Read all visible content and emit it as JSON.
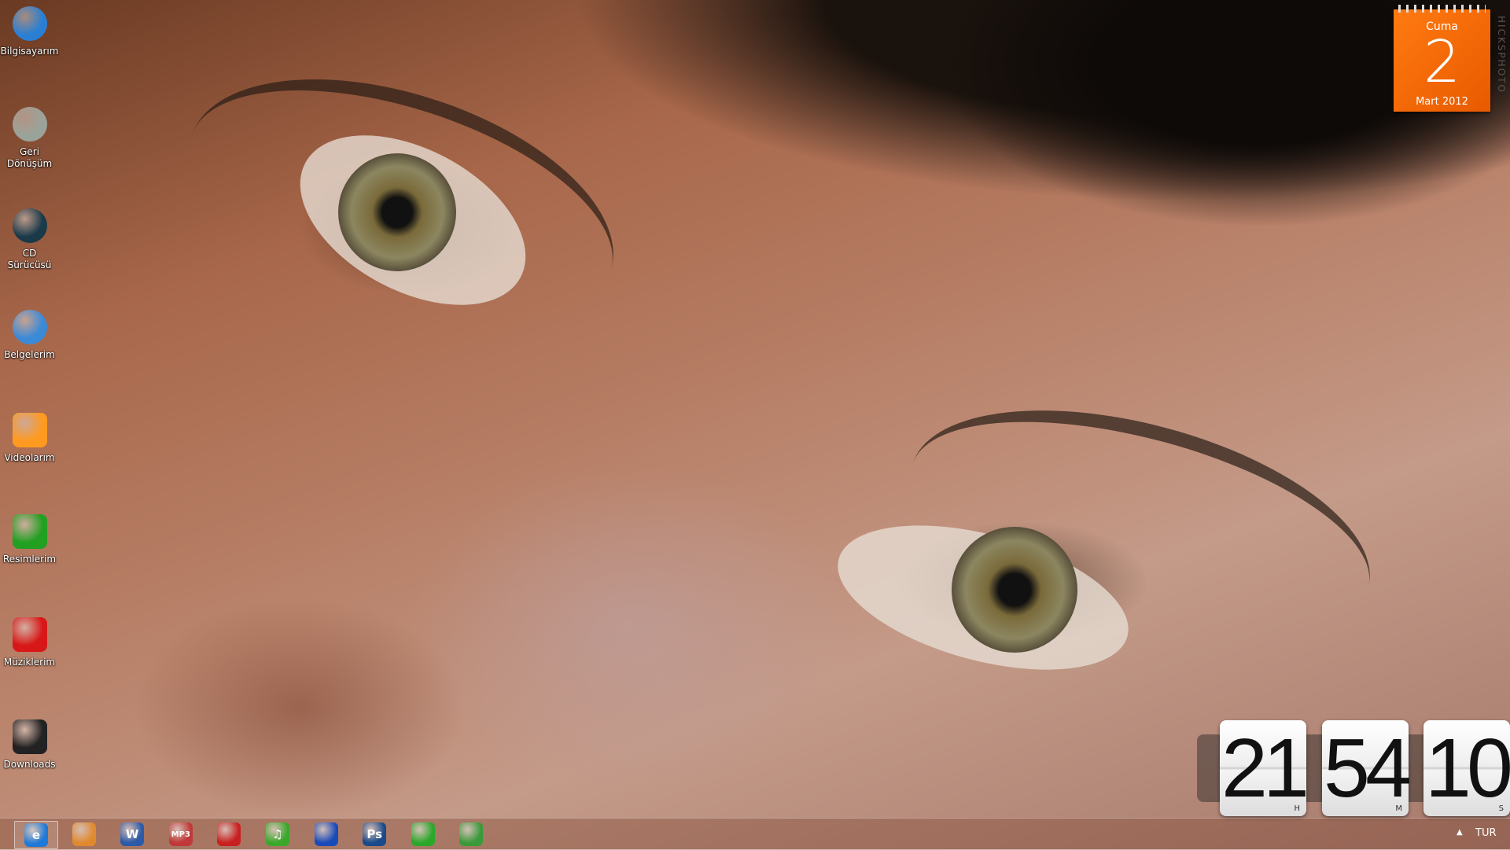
{
  "desktop": {
    "icons": [
      {
        "label": "Bilgisayarım",
        "icon": "computer-icon",
        "color": "#2a7fd4"
      },
      {
        "label": "Geri Dönüşüm",
        "icon": "recycle-bin-icon",
        "color": "#9aa39a"
      },
      {
        "label": "CD Sürücüsü",
        "icon": "cd-drive-icon",
        "color": "#1a3a4a"
      },
      {
        "label": "Belgelerim",
        "icon": "fish-icon",
        "color": "#3a8ad8"
      },
      {
        "label": "Videolarım",
        "icon": "folder-orange-icon",
        "color": "#ff9a20"
      },
      {
        "label": "Resimlerim",
        "icon": "folder-green-icon",
        "color": "#22a022"
      },
      {
        "label": "Müziklerim",
        "icon": "folder-red-icon",
        "color": "#d81818"
      },
      {
        "label": "Downloads",
        "icon": "ghost-mask-icon",
        "color": "#222222"
      }
    ]
  },
  "calendar": {
    "day_name": "Cuma",
    "day": "2",
    "month_year": "Mart 2012",
    "color": "#f26b05"
  },
  "watermark": "HICKSPHOTO",
  "clock": {
    "hours": "21",
    "minutes": "54",
    "seconds": "10",
    "h_label": "H",
    "m_label": "M",
    "s_label": "S"
  },
  "taskbar": {
    "apps": [
      {
        "name": "internet-explorer",
        "text": "e",
        "color": "#1e7ad8"
      },
      {
        "name": "msn-messenger",
        "text": "",
        "color": "#e08a30"
      },
      {
        "name": "word",
        "text": "W",
        "color": "#2a5aa8"
      },
      {
        "name": "mp3-converter",
        "text": "MP3",
        "color": "#c03838"
      },
      {
        "name": "nero",
        "text": "",
        "color": "#c82020"
      },
      {
        "name": "music-player",
        "text": "♫",
        "color": "#3aa82a"
      },
      {
        "name": "google-earth",
        "text": "",
        "color": "#1a4ab8"
      },
      {
        "name": "photoshop",
        "text": "Ps",
        "color": "#1a4a8a"
      },
      {
        "name": "downloader",
        "text": "",
        "color": "#2aa82a"
      },
      {
        "name": "globe-app",
        "text": "",
        "color": "#3a9a3a"
      }
    ],
    "tray": {
      "language": "TUR"
    }
  }
}
